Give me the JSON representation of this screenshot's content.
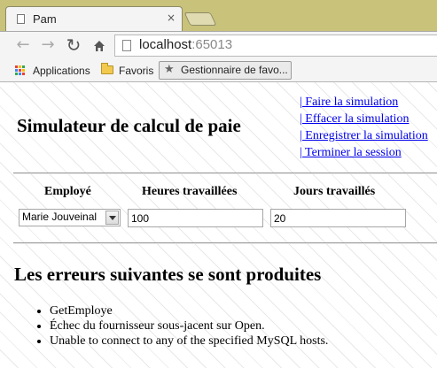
{
  "browser": {
    "tab_title": "Pam",
    "tab_close": "×",
    "url_host": "localhost",
    "url_port": ":65013",
    "bookmarks": {
      "apps": "Applications",
      "favorites": "Favoris",
      "manager": "Gestionnaire de favo..."
    },
    "icons": [
      "page-icon",
      "back-arrow-icon",
      "forward-arrow-icon",
      "reload-icon",
      "home-icon",
      "apps-grid-icon",
      "folder-icon",
      "star-icon"
    ]
  },
  "page": {
    "title": "Simulateur de calcul de paie",
    "menu": [
      "| Faire la simulation",
      "| Effacer la simulation",
      "| Enregistrer la simulation",
      "| Terminer la session"
    ],
    "form": {
      "headers": {
        "employee": "Employé",
        "hours": "Heures travaillées",
        "days": "Jours travaillés"
      },
      "employee_selected": "Marie Jouveinal",
      "hours_value": "100",
      "days_value": "20"
    },
    "errors": {
      "title": "Les erreurs suivantes se sont produites",
      "items": [
        "GetEmploye",
        "Échec du fournisseur sous-jacent sur Open.",
        "Unable to connect to any of the specified MySQL hosts."
      ]
    }
  },
  "colors": {
    "window_frame": "#c5c07a",
    "link": "#0000ee",
    "page_background": "#ffffff"
  }
}
